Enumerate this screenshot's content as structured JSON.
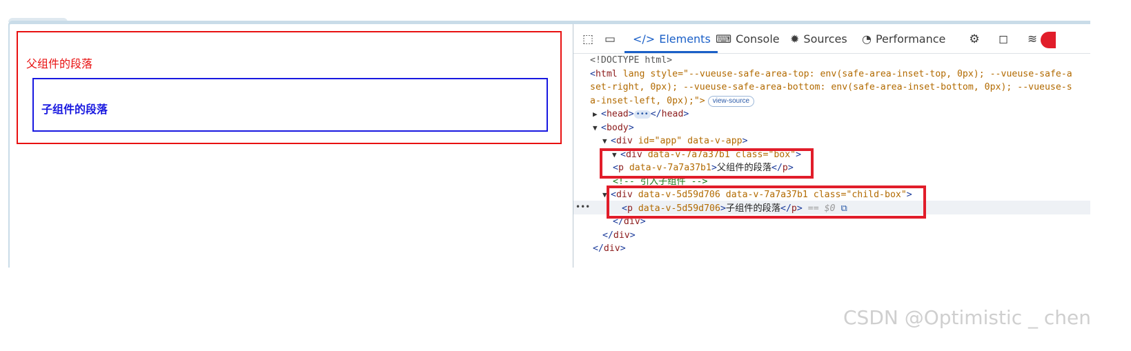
{
  "viewport": {
    "parent_paragraph": "父组件的段落",
    "child_paragraph": "子组件的段落"
  },
  "devtools": {
    "tabs": [
      {
        "label": "Elements",
        "icon": "code-icon",
        "active": true
      },
      {
        "label": "Console",
        "icon": "console-icon",
        "active": false
      },
      {
        "label": "Sources",
        "icon": "bug-icon",
        "active": false
      },
      {
        "label": "Performance",
        "icon": "gauge-icon",
        "active": false
      }
    ],
    "toolbar_icons": [
      "inspect-icon",
      "device-icon",
      "cpu-icon",
      "dock-icon",
      "wifi-icon"
    ],
    "dom": {
      "doctype": "<!DOCTYPE html>",
      "html_line1": "lang style=\"--vueuse-safe-area-top: env(safe-area-inset-top, 0px); --vueuse-safe-a",
      "html_line2": "set-right, 0px); --vueuse-safe-area-bottom: env(safe-area-inset-bottom, 0px); --vueuse-s",
      "html_line3": "a-inset-left, 0px);\">",
      "view_source": "view-source",
      "head": "head",
      "body": "body",
      "app_div_attrs": " id=\"app\" data-v-app",
      "box_div_attrs": " data-v-7a7a37b1 class=\"box\"",
      "p_parent_attrs": " data-v-7a7a37b1",
      "p_parent_text": "父组件的段落",
      "comment": "<!-- 引入子组件 -->",
      "child_div_attrs": " data-v-5d59d706 data-v-7a7a37b1 class=\"child-box\"",
      "p_child_attrs": " data-v-5d59d706",
      "p_child_text": "子组件的段落",
      "selected_marker": "== $0"
    }
  },
  "watermark": "CSDN @Optimistic _ chen",
  "colors": {
    "parent": "#e81010",
    "child": "#1818e0",
    "highlight": "#e11d2a",
    "accent": "#1a5fc7"
  }
}
